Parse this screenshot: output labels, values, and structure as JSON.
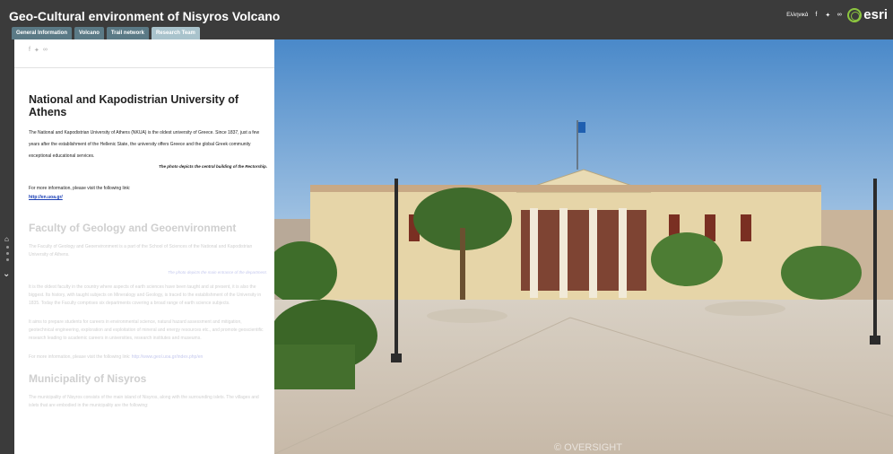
{
  "header": {
    "title": "Geo-Cultural environment of Nisyros Volcano",
    "tabs": [
      "General Information",
      "Volcano",
      "Trail network",
      "Research Team"
    ],
    "language": "Ελληνικά",
    "share_icons": [
      "facebook-icon",
      "twitter-icon",
      "link-icon"
    ],
    "logo_text": "esri",
    "colors": {
      "background": "#3b3b3b",
      "tab": "#5b7a86",
      "tab_active": "#a9c3cc",
      "esri_green": "#8cc63f"
    }
  },
  "panel": {
    "share_icons": [
      "facebook-icon",
      "twitter-icon",
      "link-icon"
    ],
    "section1": {
      "title": "National and Kapodistrian University of Athens",
      "body": "The National and Kapodistrian University of Athens (NKUA) is the oldest university of Greece. Since 1837, just a few years after the establishment of the Hellenic State, the university offers Greece and the global Greek community exceptional educational services.",
      "caption": "The photo depicts the central building of the Rectorship.",
      "info": "For more information, please visit the following link:",
      "link": "http://en.uoa.gr/"
    },
    "section2": {
      "title": "Faculty of Geology and Geoenvironment",
      "p1": "The Faculty of Geology and Geoenvironment is a part of the School of Sciences of the National and Kapodistrian University of Athens.",
      "caption": "The photo depicts the main entrance of the department.",
      "p2": "It is the oldest faculty in the country where aspects of earth sciences have been taught and at present, it is also the biggest. Its history, with taught subjects on Mineralogy and Geology, is traced to the establishment of the University in 1835. Today the Faculty comprises six departments covering a broad range of earth science subjects.",
      "p3": "It aims to prepare students for careers in environmental science, natural hazard assessment and mitigation, geotechnical engineering, exploration and exploitation of mineral and energy resources etc., and promote geoscientific research leading to academic careers in universities, research institutes and museums.",
      "info": "For more information, please visit the following link:",
      "link": "http://www.geol.uoa.gr/index.php/en"
    },
    "section3": {
      "title": "Municipality of Nisyros",
      "p1": "The municipality of Nisyros consists of the main island of Nisyros, along with the surrounding islets. The villages and islets that are embodied in the municipality are the following:"
    }
  },
  "nav": {
    "icons": [
      "home-icon",
      "chevron-down-icon"
    ]
  },
  "photo": {
    "subject": "University of Athens main building",
    "watermark": "© OVERSIGHT"
  }
}
